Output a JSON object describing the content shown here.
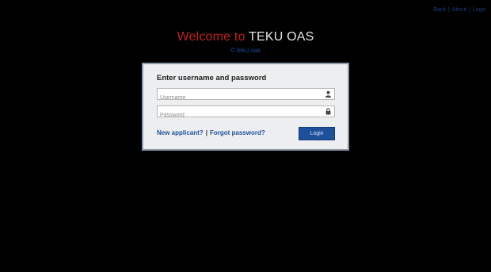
{
  "top_links": {
    "items": [
      "Back",
      "About",
      "Login"
    ],
    "separator": "|"
  },
  "header": {
    "welcome_text": "Welcome to",
    "app_name": "TEKU OAS",
    "copyright": "© teku oas"
  },
  "login_form": {
    "heading": "Enter username and password",
    "username_placeholder": "Username",
    "password_placeholder": "Password",
    "new_applicant_link": "New applicant?",
    "link_separator": "|",
    "forgot_password_link": "Forgot password?",
    "login_button": "Login"
  },
  "icons": {
    "username": "user-icon",
    "password": "lock-icon"
  },
  "colors": {
    "background": "#000000",
    "welcome_red": "#c0201e",
    "link_blue": "#1f4f9e",
    "button_blue": "#1e4f9a",
    "panel_bg": "#eceeef"
  }
}
